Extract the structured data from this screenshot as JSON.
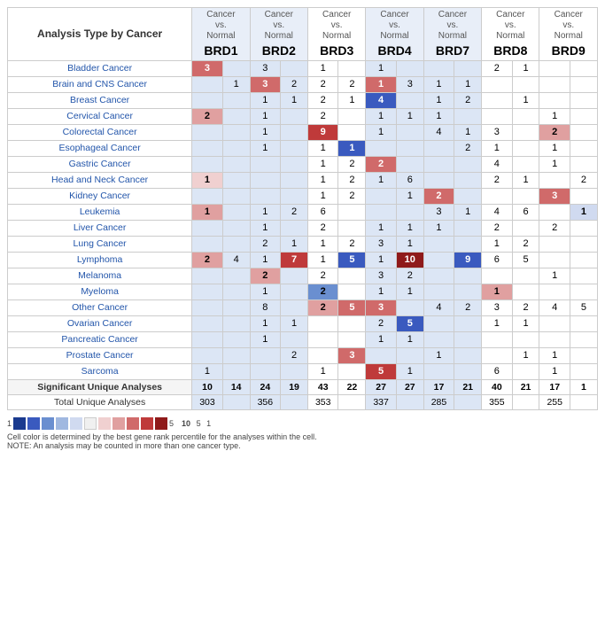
{
  "title": "Analysis Type by Cancer",
  "columns": [
    {
      "label": "Cancer vs. Normal",
      "gene": "BRD1",
      "shade": "blue"
    },
    {
      "label": "Cancer vs. Normal",
      "gene": "BRD2",
      "shade": "blue"
    },
    {
      "label": "Cancer vs. Normal",
      "gene": "BRD3",
      "shade": "white"
    },
    {
      "label": "Cancer vs. Normal",
      "gene": "BRD4",
      "shade": "blue"
    },
    {
      "label": "Cancer vs. Normal",
      "gene": "BRD7",
      "shade": "blue"
    },
    {
      "label": "Cancer vs. Normal",
      "gene": "BRD8",
      "shade": "white"
    },
    {
      "label": "Cancer vs. Normal",
      "gene": "BRD9",
      "shade": "white"
    }
  ],
  "rows": [
    {
      "cancer": "Bladder Cancer",
      "cells": [
        [
          "3",
          "r3",
          ""
        ],
        [
          "",
          "",
          "3"
        ],
        [
          "1",
          "",
          ""
        ],
        [
          "1",
          "",
          ""
        ],
        [
          "",
          "",
          ""
        ],
        [
          "2",
          "",
          "1"
        ]
      ]
    },
    {
      "cancer": "Brain and CNS Cancer",
      "cells": [
        [
          "",
          "",
          "1"
        ],
        [
          "3",
          "r3",
          "2"
        ],
        [
          "2",
          "",
          "2"
        ],
        [
          "1",
          "r3",
          "3"
        ],
        [
          "1",
          "",
          "1"
        ],
        [
          "",
          "",
          ""
        ]
      ]
    },
    {
      "cancer": "Breast Cancer",
      "cells": [
        [
          "",
          "",
          "1"
        ],
        [
          "1",
          "",
          ""
        ],
        [
          "2",
          "",
          "1"
        ],
        [
          "4",
          "b4",
          ""
        ],
        [
          "1",
          "",
          "2"
        ],
        [
          "1",
          "",
          ""
        ]
      ]
    },
    {
      "cancer": "Cervical Cancer",
      "cells": [
        [
          "2",
          "r2",
          ""
        ],
        [
          "1",
          "",
          ""
        ],
        [
          "2",
          "",
          ""
        ],
        [
          "1",
          "",
          "1"
        ],
        [
          "1",
          "",
          ""
        ],
        [
          "",
          "",
          "1"
        ]
      ]
    },
    {
      "cancer": "Colorectal Cancer",
      "cells": [
        [
          "",
          "",
          "1"
        ],
        [
          "9",
          "r4",
          ""
        ],
        [
          "1",
          "",
          ""
        ],
        [
          "4",
          "",
          "1"
        ],
        [
          "3",
          "",
          ""
        ],
        [
          "2",
          "r2",
          ""
        ]
      ]
    },
    {
      "cancer": "Esophageal Cancer",
      "cells": [
        [
          "",
          "",
          "1"
        ],
        [
          "1",
          "",
          "1"
        ],
        [
          "1",
          "b4",
          ""
        ],
        [
          "",
          "",
          "2"
        ],
        [
          "1",
          "",
          ""
        ],
        [
          "1",
          "",
          ""
        ]
      ]
    },
    {
      "cancer": "Gastric Cancer",
      "cells": [
        [
          "",
          "",
          ""
        ],
        [
          "1",
          "",
          "2"
        ],
        [
          "2",
          "r3",
          ""
        ],
        [
          "",
          "",
          "4"
        ],
        [
          "",
          "",
          ""
        ],
        [
          "1",
          "",
          ""
        ]
      ]
    },
    {
      "cancer": "Head and Neck Cancer",
      "cells": [
        [
          "1",
          "r1",
          ""
        ],
        [
          "1",
          "",
          "2"
        ],
        [
          "1",
          "",
          "6"
        ],
        [
          "",
          "",
          "2"
        ],
        [
          "1",
          "",
          ""
        ],
        [
          "2",
          "",
          ""
        ]
      ]
    },
    {
      "cancer": "Kidney Cancer",
      "cells": [
        [
          "",
          "",
          ""
        ],
        [
          "1",
          "",
          "2"
        ],
        [
          "",
          "",
          "1"
        ],
        [
          "2",
          "r3",
          ""
        ],
        [
          "",
          "",
          ""
        ],
        [
          "3",
          "r3",
          ""
        ]
      ]
    },
    {
      "cancer": "Leukemia",
      "cells": [
        [
          "1",
          "r2",
          "1"
        ],
        [
          "2",
          "",
          "6"
        ],
        [
          "",
          "",
          "3"
        ],
        [
          "1",
          "",
          "4"
        ],
        [
          "6",
          "",
          ""
        ],
        [
          "1",
          "b1",
          ""
        ]
      ]
    },
    {
      "cancer": "Liver Cancer",
      "cells": [
        [
          "",
          "",
          "1"
        ],
        [
          "2",
          "",
          ""
        ],
        [
          "1",
          "",
          "1"
        ],
        [
          "1",
          "",
          "2"
        ],
        [
          "",
          "",
          ""
        ],
        [
          "2",
          "",
          ""
        ]
      ]
    },
    {
      "cancer": "Lung Cancer",
      "cells": [
        [
          "2",
          "",
          "1"
        ],
        [
          "1",
          "",
          "2"
        ],
        [
          "3",
          "",
          "1"
        ],
        [
          "",
          "",
          "1"
        ],
        [
          "2",
          "",
          ""
        ],
        [
          "",
          "",
          ""
        ]
      ]
    },
    {
      "cancer": "Lymphoma",
      "cells": [
        [
          "2",
          "r2",
          "4"
        ],
        [
          "1",
          "",
          "7"
        ],
        [
          "1",
          "b4",
          "5"
        ],
        [
          "1",
          "",
          "10"
        ],
        [
          "9",
          "b4",
          "6"
        ],
        [
          "5",
          "",
          ""
        ],
        [
          "",
          "",
          ""
        ]
      ]
    },
    {
      "cancer": "Melanoma",
      "cells": [
        [
          "",
          "",
          "2"
        ],
        [
          "",
          "",
          "2"
        ],
        [
          "3",
          "",
          "2"
        ],
        [
          "",
          "",
          ""
        ],
        [
          "",
          "",
          ""
        ],
        [
          "1",
          "",
          ""
        ]
      ]
    },
    {
      "cancer": "Myeloma",
      "cells": [
        [
          "",
          "",
          "1"
        ],
        [
          "2",
          "b3",
          ""
        ],
        [
          "1",
          "",
          "1"
        ],
        [
          "",
          "",
          "1"
        ],
        [
          "r2",
          "",
          ""
        ],
        [
          "",
          "",
          ""
        ]
      ]
    },
    {
      "cancer": "Other Cancer",
      "cells": [
        [
          "",
          "",
          "8"
        ],
        [
          "2",
          "r2",
          "5"
        ],
        [
          "3",
          "r3",
          ""
        ],
        [
          "4",
          "",
          "2"
        ],
        [
          "3",
          "",
          "2"
        ],
        [
          "4",
          "",
          "5"
        ]
      ]
    },
    {
      "cancer": "Ovarian Cancer",
      "cells": [
        [
          "",
          "",
          "1"
        ],
        [
          "1",
          "",
          ""
        ],
        [
          "2",
          "",
          "5"
        ],
        [
          "b4",
          "",
          ""
        ],
        [
          "1",
          "",
          "1"
        ],
        [
          "1",
          "",
          ""
        ]
      ]
    },
    {
      "cancer": "Pancreatic Cancer",
      "cells": [
        [
          "",
          "",
          "1"
        ],
        [
          "",
          "",
          ""
        ],
        [
          "1",
          "",
          "1"
        ],
        [
          "1",
          "",
          ""
        ],
        [
          "",
          "",
          ""
        ],
        [
          "",
          "",
          ""
        ]
      ]
    },
    {
      "cancer": "Prostate Cancer",
      "cells": [
        [
          "",
          "",
          "2"
        ],
        [
          "",
          "",
          "3"
        ],
        [
          "r3",
          "",
          ""
        ],
        [
          "1",
          "",
          ""
        ],
        [
          "",
          "",
          "1"
        ],
        [
          "1",
          "",
          ""
        ]
      ]
    },
    {
      "cancer": "Sarcoma",
      "cells": [
        [
          "1",
          "",
          ""
        ],
        [
          "",
          "",
          "1"
        ],
        [
          "5",
          "r4",
          ""
        ],
        [
          "1",
          "",
          ""
        ],
        [
          "6",
          "",
          ""
        ],
        [
          "1",
          "",
          ""
        ]
      ]
    }
  ],
  "footer_sig": {
    "label": "Significant Unique Analyses",
    "vals": [
      "10",
      "14",
      "24",
      "19",
      "43",
      "22",
      "27",
      "27",
      "17",
      "21",
      "40",
      "21",
      "17",
      "1"
    ]
  },
  "footer_total": {
    "label": "Total Unique Analyses",
    "vals": [
      "303",
      "356",
      "353",
      "337",
      "285",
      "355",
      "255"
    ]
  },
  "legend": {
    "note1": "Cell color is determined by the best gene rank percentile for the analyses within the cell.",
    "note2": "NOTE: An analysis may be counted in more than one cancer type.",
    "scale_labels": [
      "1",
      "5",
      "10",
      "5",
      "1"
    ]
  }
}
